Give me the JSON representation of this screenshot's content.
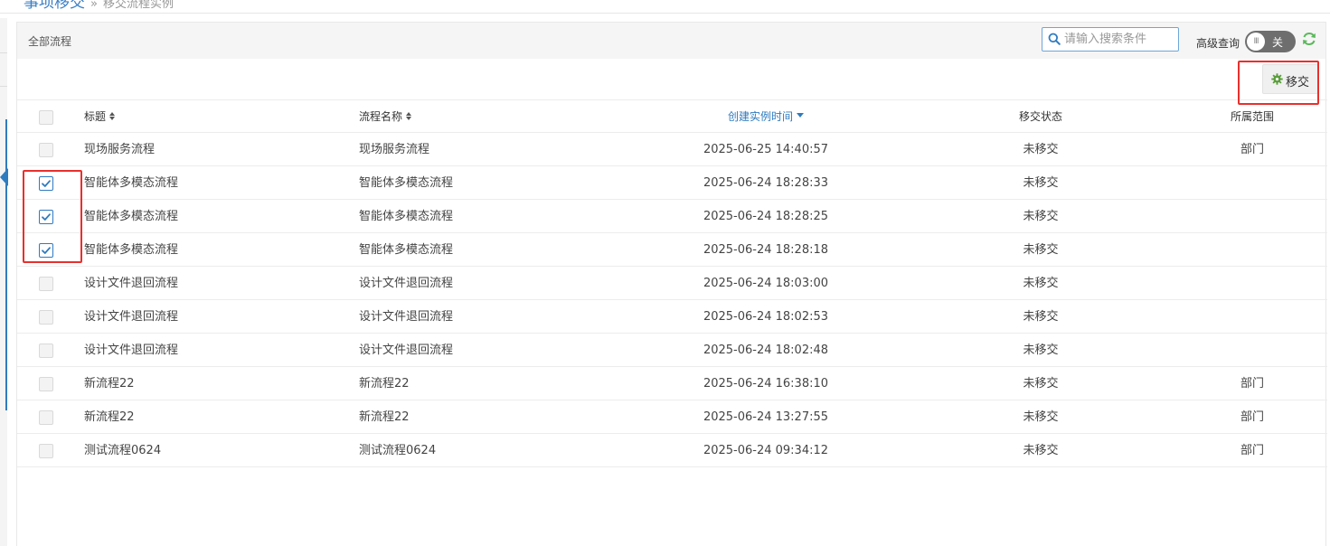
{
  "breadcrumb": {
    "root": "事项移交",
    "current": "移交流程实例"
  },
  "panel": {
    "title": "全部流程"
  },
  "search": {
    "placeholder": "请输入搜索条件",
    "value": ""
  },
  "advanced": {
    "label": "高级查询",
    "toggle_text": "关",
    "toggle_knob": "III",
    "state": "off"
  },
  "toolbar": {
    "transfer_label": "移交"
  },
  "table": {
    "columns": [
      "标题",
      "流程名称",
      "创建实例时间",
      "移交状态",
      "所属范围"
    ],
    "rows": [
      {
        "checked": false,
        "title": "现场服务流程",
        "name": "现场服务流程",
        "time": "2025-06-25 14:40:57",
        "status": "未移交",
        "scope": "部门"
      },
      {
        "checked": true,
        "title": "智能体多模态流程",
        "name": "智能体多模态流程",
        "time": "2025-06-24 18:28:33",
        "status": "未移交",
        "scope": ""
      },
      {
        "checked": true,
        "title": "智能体多模态流程",
        "name": "智能体多模态流程",
        "time": "2025-06-24 18:28:25",
        "status": "未移交",
        "scope": ""
      },
      {
        "checked": true,
        "title": "智能体多模态流程",
        "name": "智能体多模态流程",
        "time": "2025-06-24 18:28:18",
        "status": "未移交",
        "scope": ""
      },
      {
        "checked": false,
        "title": "设计文件退回流程",
        "name": "设计文件退回流程",
        "time": "2025-06-24 18:03:00",
        "status": "未移交",
        "scope": ""
      },
      {
        "checked": false,
        "title": "设计文件退回流程",
        "name": "设计文件退回流程",
        "time": "2025-06-24 18:02:53",
        "status": "未移交",
        "scope": ""
      },
      {
        "checked": false,
        "title": "设计文件退回流程",
        "name": "设计文件退回流程",
        "time": "2025-06-24 18:02:48",
        "status": "未移交",
        "scope": ""
      },
      {
        "checked": false,
        "title": "新流程22",
        "name": "新流程22",
        "time": "2025-06-24 16:38:10",
        "status": "未移交",
        "scope": "部门"
      },
      {
        "checked": false,
        "title": "新流程22",
        "name": "新流程22",
        "time": "2025-06-24 13:27:55",
        "status": "未移交",
        "scope": "部门"
      },
      {
        "checked": false,
        "title": "测试流程0624",
        "name": "测试流程0624",
        "time": "2025-06-24 09:34:12",
        "status": "未移交",
        "scope": "部门"
      }
    ]
  },
  "colors": {
    "accent": "#2f7bbf",
    "highlight": "#e8302c",
    "toggle_bg": "#6e6e6e",
    "refresh": "#5cb85c",
    "gear": "#5a9e3a"
  },
  "icons": {
    "search": "search-icon",
    "refresh": "refresh-icon",
    "gear": "gear-icon",
    "sort": "sort-icon"
  }
}
